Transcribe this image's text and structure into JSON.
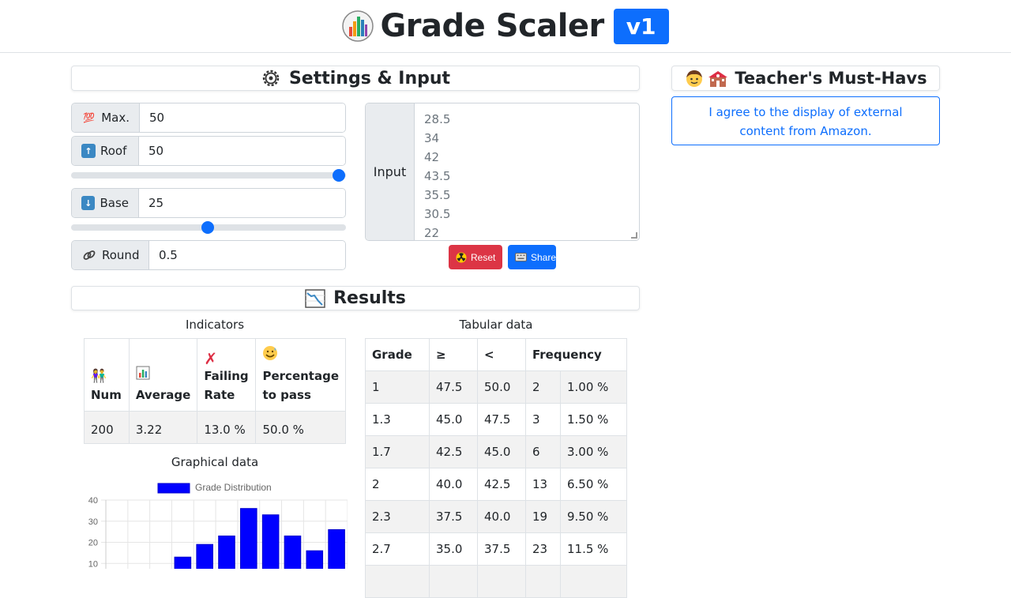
{
  "header": {
    "title": "Grade Scaler",
    "version": "v1"
  },
  "settings": {
    "title": "Settings & Input",
    "max": {
      "label": "Max.",
      "value": "50"
    },
    "roof": {
      "label": "Roof",
      "value": "50",
      "slider_level": 1.0
    },
    "base": {
      "label": "Base",
      "value": "25",
      "slider_level": 0.5
    },
    "round": {
      "label": "Round",
      "value": "0.5"
    },
    "input": {
      "label": "Input",
      "values": [
        "28.5",
        "34",
        "42",
        "43.5",
        "35.5",
        "30.5",
        "22"
      ]
    },
    "reset_label": "Reset",
    "share_label": "Share"
  },
  "results": {
    "title": "Results",
    "indicators": {
      "title": "Indicators",
      "headers": [
        "Num",
        "Average",
        "Failing Rate",
        "Percentage to pass"
      ],
      "values": [
        "200",
        "3.22",
        "13.0 %",
        "50.0 %"
      ]
    },
    "tabular": {
      "title": "Tabular data",
      "headers": [
        "Grade",
        "≥",
        "<",
        "Frequency"
      ],
      "rows": [
        [
          "1",
          "47.5",
          "50.0",
          "2",
          "1.00 %"
        ],
        [
          "1.3",
          "45.0",
          "47.5",
          "3",
          "1.50 %"
        ],
        [
          "1.7",
          "42.5",
          "45.0",
          "6",
          "3.00 %"
        ],
        [
          "2",
          "40.0",
          "42.5",
          "13",
          "6.50 %"
        ],
        [
          "2.3",
          "37.5",
          "40.0",
          "19",
          "9.50 %"
        ],
        [
          "2.7",
          "35.0",
          "37.5",
          "23",
          "11.5 %"
        ]
      ]
    },
    "graph_title": "Graphical data"
  },
  "sidebar": {
    "title": "Teacher's Must-Havs",
    "consent_text": "I agree to the display of external content from Amazon."
  },
  "chart_data": {
    "type": "bar",
    "legend": "Grade Distribution",
    "legend_position": "top",
    "color": "#0000ff",
    "ylim": [
      0,
      40
    ],
    "yticks": [
      "40",
      "30",
      "20",
      "10"
    ],
    "values": [
      0,
      0,
      0,
      13,
      19,
      23,
      36,
      33,
      23,
      16,
      26
    ],
    "grid": true
  }
}
